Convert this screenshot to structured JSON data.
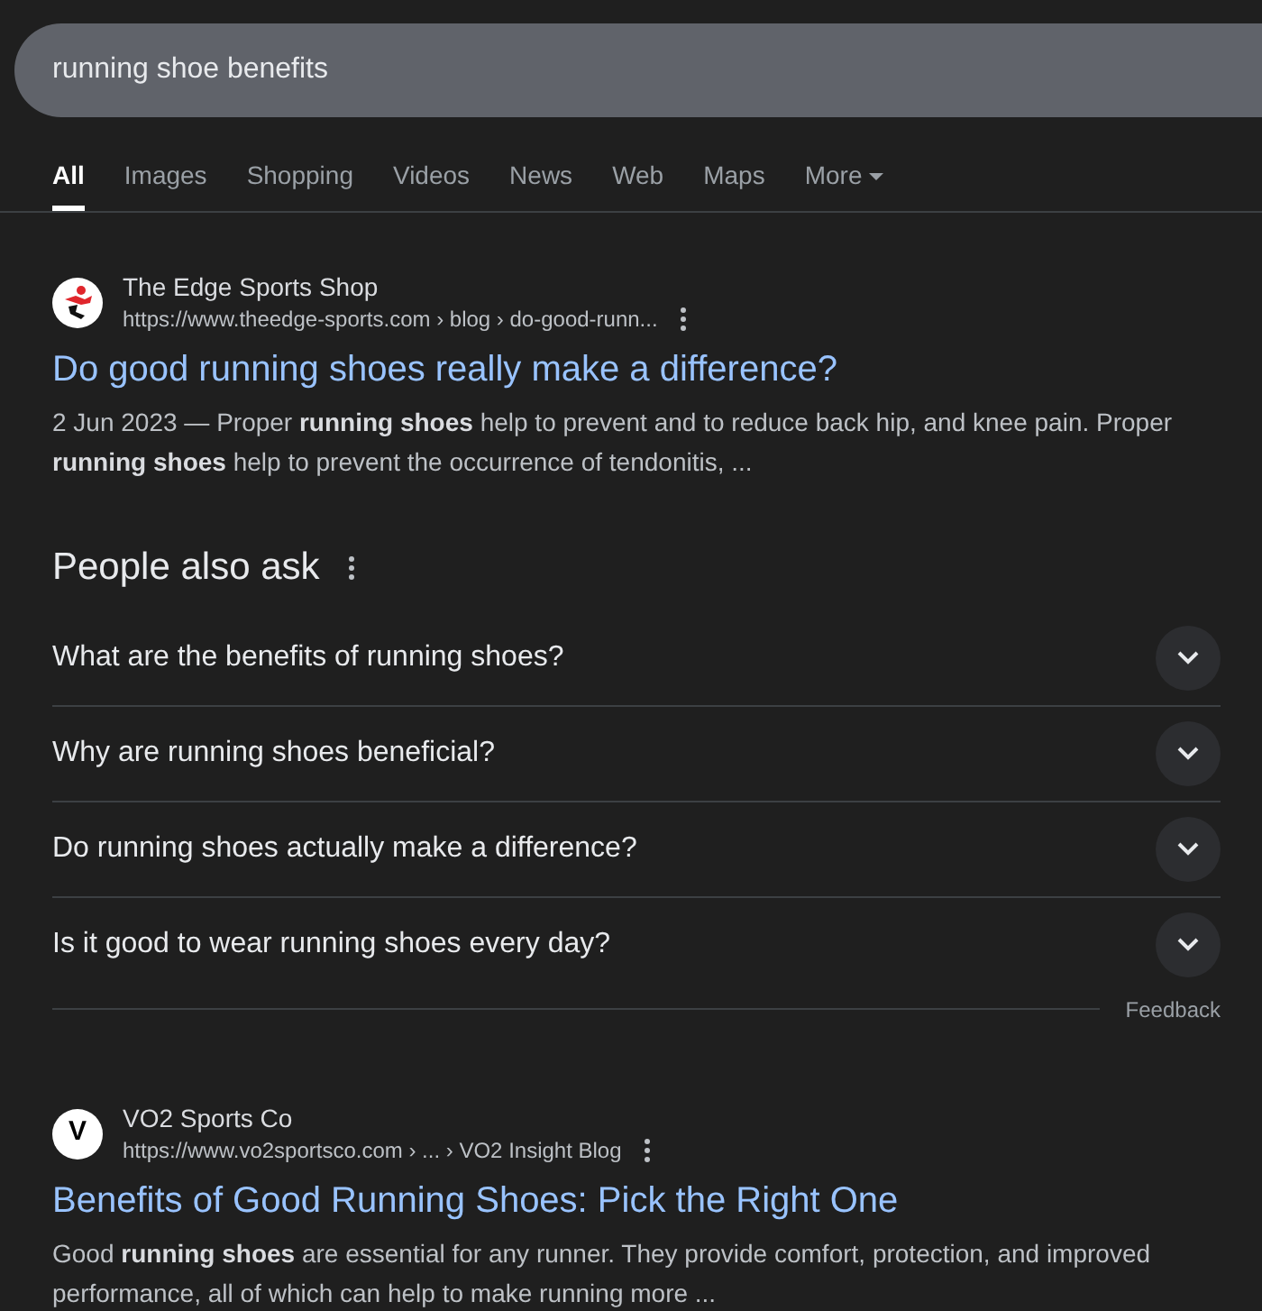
{
  "search": {
    "value": "running shoe benefits"
  },
  "tabs": [
    {
      "label": "All",
      "selected": true
    },
    {
      "label": "Images",
      "selected": false
    },
    {
      "label": "Shopping",
      "selected": false
    },
    {
      "label": "Videos",
      "selected": false
    },
    {
      "label": "News",
      "selected": false
    },
    {
      "label": "Web",
      "selected": false
    },
    {
      "label": "Maps",
      "selected": false
    },
    {
      "label": "More",
      "selected": false,
      "kind": "menu"
    }
  ],
  "results": [
    {
      "site": "The Edge Sports Shop",
      "url": "https://www.theedge-sports.com › blog › do-good-runn...",
      "title": "Do good running shoes really make a difference?",
      "date": "2 Jun 2023 —",
      "snippet": "Proper **running shoes** help to prevent and to reduce back hip, and knee pain. Proper **running shoes** help to prevent the occurrence of tendonitis, ...",
      "logo": {
        "kind": "runner"
      }
    }
  ],
  "people_also_ask": {
    "title": "People also ask",
    "questions": [
      {
        "text": "What are the benefits of running shoes?",
        "expanded": false
      },
      {
        "text": "Why are running shoes beneficial?",
        "expanded": false
      },
      {
        "text": "Do running shoes actually make a difference?",
        "expanded": false
      },
      {
        "text": "Is it good to wear running shoes every day?",
        "expanded": false
      }
    ],
    "feedback": "Feedback"
  },
  "results_after": [
    {
      "site": "VO2 Sports Co",
      "url": "https://www.vo2sportsco.com › ... › VO2 Insight Blog",
      "title": "Benefits of Good Running Shoes: Pick the Right One",
      "snippet": "Good **running shoes** are essential for any runner. They provide comfort, protection, and improved performance, all of which can help to make running more ...",
      "logo": {
        "kind": "letter",
        "text": "V"
      }
    }
  ]
}
